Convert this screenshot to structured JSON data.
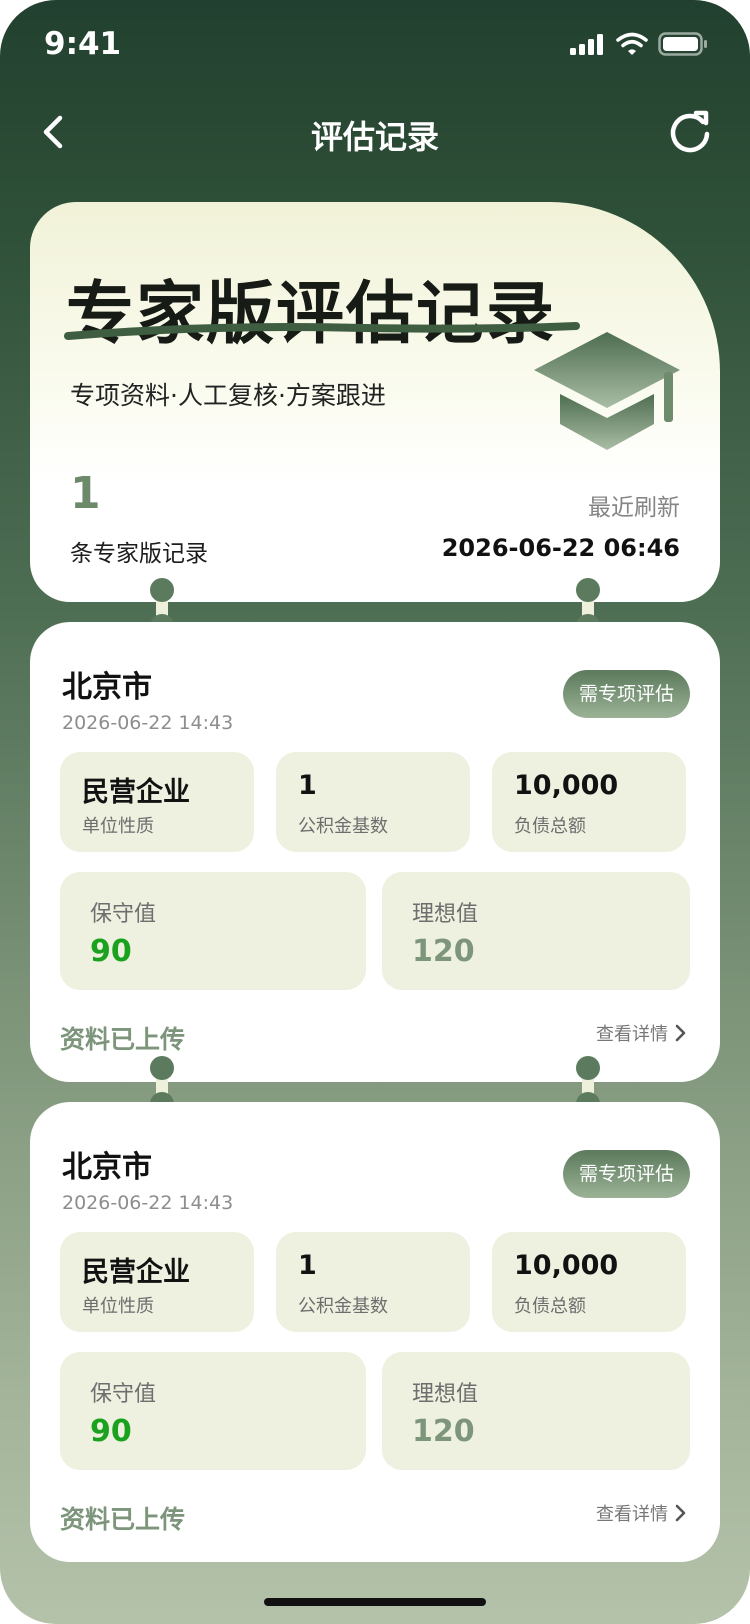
{
  "status_bar": {
    "time": "9:41"
  },
  "nav": {
    "title": "评估记录"
  },
  "hero": {
    "title": "专家版评估记录",
    "subtitle": "专项资料·人工复核·方案跟进",
    "count": "1",
    "count_label": "条专家版记录",
    "refresh_label": "最近刷新",
    "refresh_time": "2026-06-22 06:46"
  },
  "records": [
    {
      "city": "北京市",
      "date": "2026-06-22 14:43",
      "badge": "需专项评估",
      "tiles": [
        {
          "value": "民营企业",
          "label": "单位性质"
        },
        {
          "value": "1",
          "label": "公积金基数"
        },
        {
          "value": "10,000",
          "label": "负债总额"
        }
      ],
      "conservative_label": "保守值",
      "conservative_value": "90",
      "ideal_label": "理想值",
      "ideal_value": "120",
      "upload_status": "资料已上传",
      "detail_link": "查看详情"
    },
    {
      "city": "北京市",
      "date": "2026-06-22 14:43",
      "badge": "需专项评估",
      "tiles": [
        {
          "value": "民营企业",
          "label": "单位性质"
        },
        {
          "value": "1",
          "label": "公积金基数"
        },
        {
          "value": "10,000",
          "label": "负债总额"
        }
      ],
      "conservative_label": "保守值",
      "conservative_value": "90",
      "ideal_label": "理想值",
      "ideal_value": "120",
      "upload_status": "资料已上传",
      "detail_link": "查看详情"
    }
  ],
  "colors": {
    "accent": "#5c7a5e",
    "conservative_value": "#1aa11e",
    "ideal_value": "#7d957b"
  },
  "icons": {
    "back": "chevron-left-icon",
    "refresh": "refresh-icon",
    "hero": "graduation-cap-icon",
    "detail": "chevron-right-icon"
  }
}
